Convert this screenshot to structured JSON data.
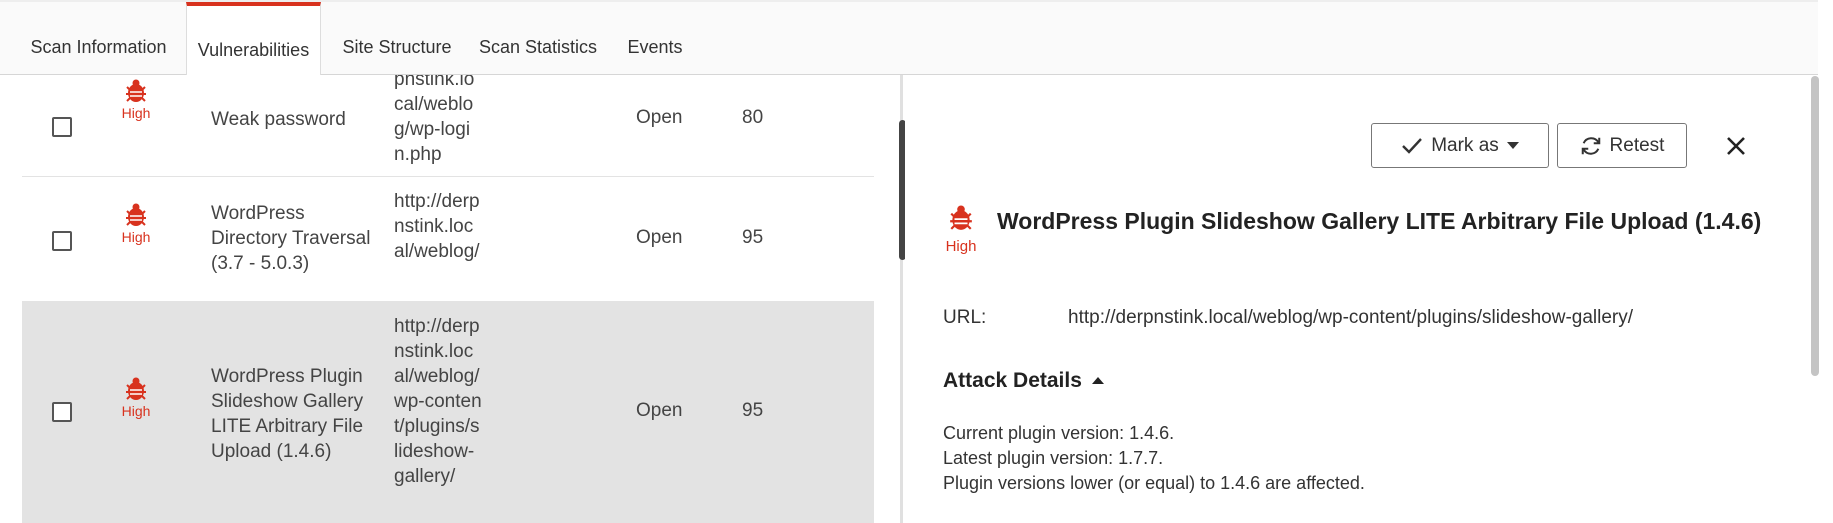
{
  "tabs": [
    {
      "label": "Scan Information"
    },
    {
      "label": "Vulnerabilities"
    },
    {
      "label": "Site Structure"
    },
    {
      "label": "Scan Statistics"
    },
    {
      "label": "Events"
    }
  ],
  "rows": [
    {
      "severity": "High",
      "name": "Weak password",
      "url": "pnstink.local/weblog/wp-login.php",
      "status": "Open",
      "confidence": "80"
    },
    {
      "severity": "High",
      "name": "WordPress Directory Traversal (3.7 - 5.0.3)",
      "url": "http://derpnstink.local/weblog/",
      "status": "Open",
      "confidence": "95"
    },
    {
      "severity": "High",
      "name": "WordPress Plugin Slideshow Gallery LITE Arbitrary File Upload (1.4.6)",
      "url": "http://derpnstink.local/weblog/wp-content/plugins/slideshow-gallery/",
      "status": "Open",
      "confidence": "95"
    }
  ],
  "detail": {
    "mark_as_label": "Mark as",
    "retest_label": "Retest",
    "severity": "High",
    "title": "WordPress Plugin Slideshow Gallery LITE Arbitrary File Upload (1.4.6)",
    "url_label": "URL:",
    "url_value": "http://derpnstink.local/weblog/wp-content/plugins/slideshow-gallery/",
    "attack_details_label": "Attack Details",
    "attack_lines": [
      "Current plugin version: 1.4.6.",
      "Latest plugin version: 1.7.7.",
      "Plugin versions lower (or equal) to 1.4.6 are affected."
    ]
  },
  "colors": {
    "accent": "#d8321e",
    "selected_row": "#e3e3e3"
  }
}
